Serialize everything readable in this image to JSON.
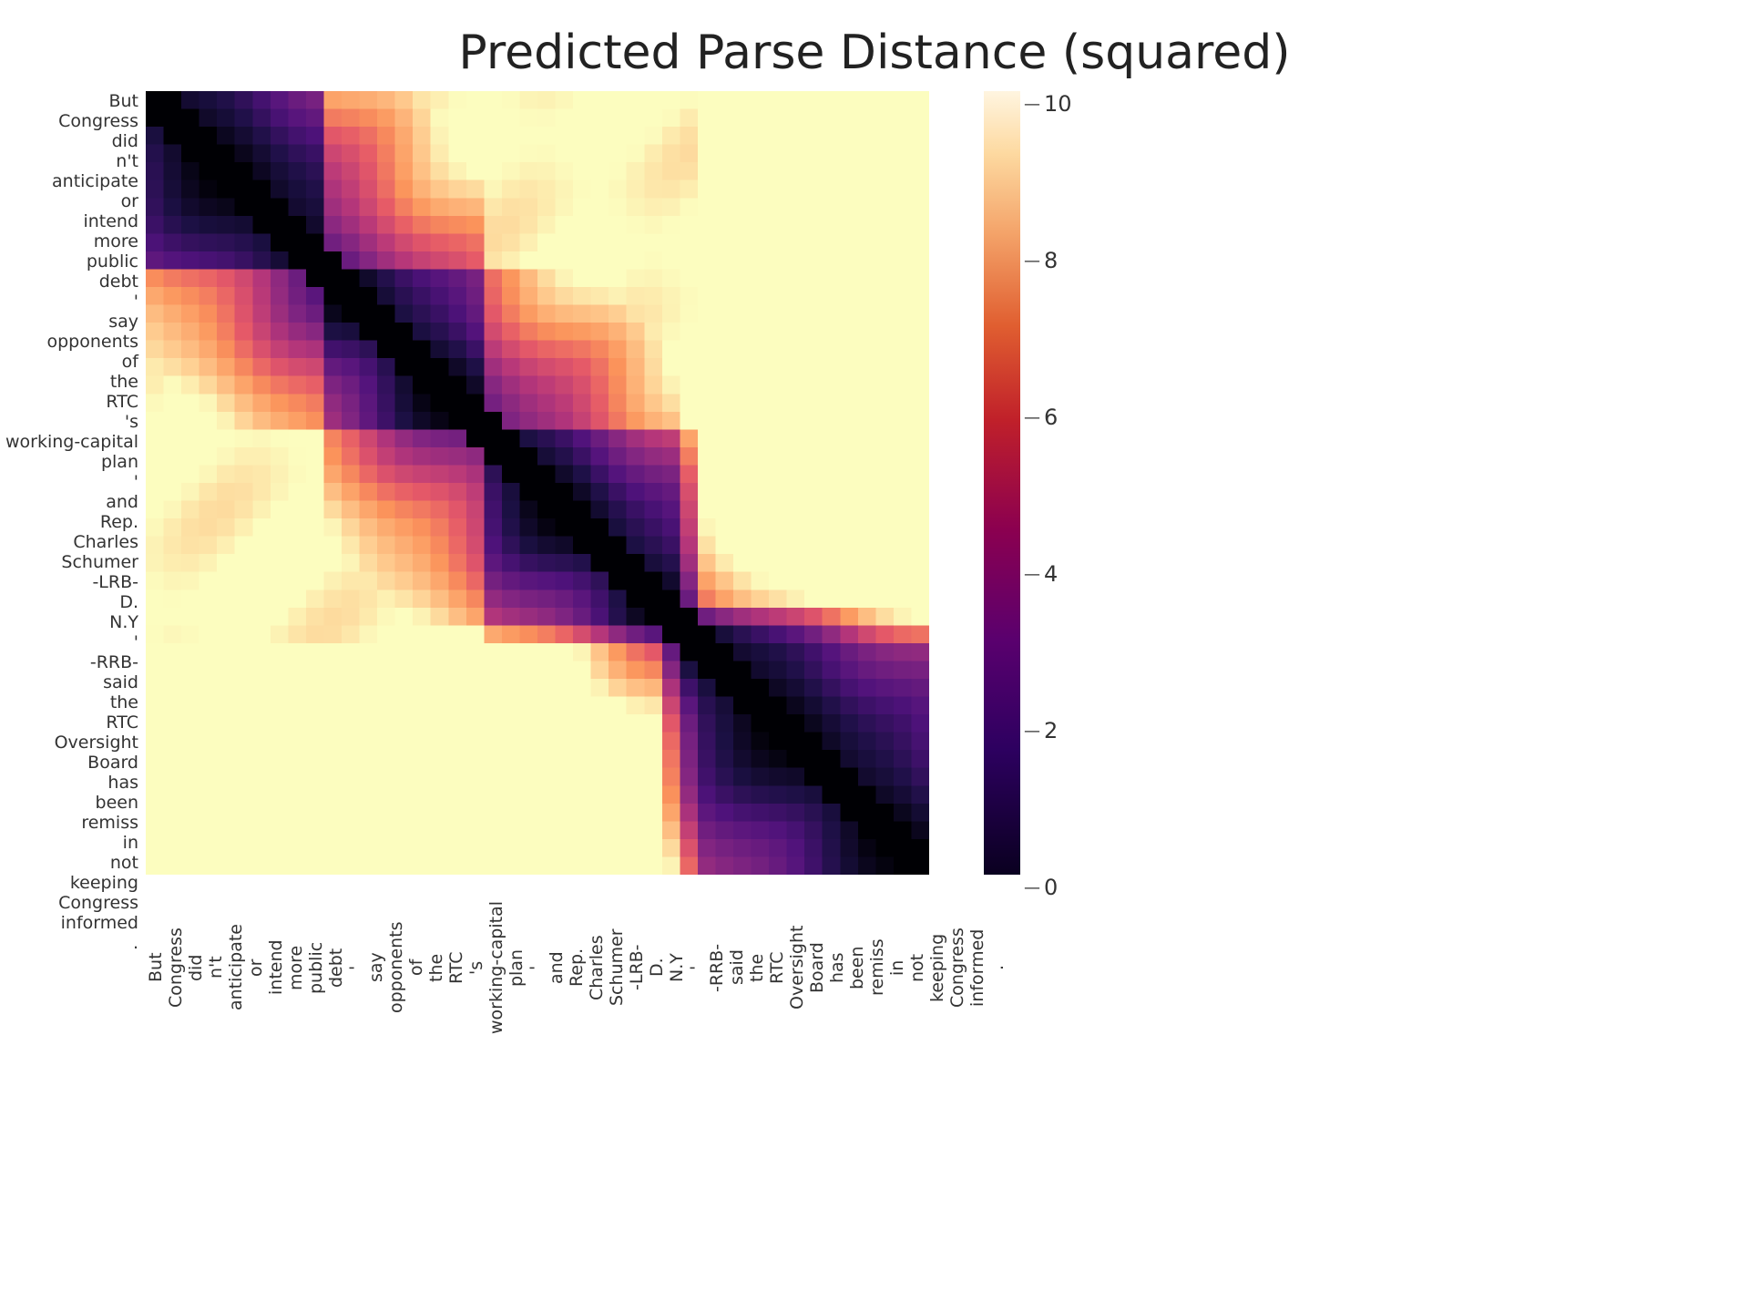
{
  "title": "Predicted Parse Distance (squared)",
  "y_labels": [
    "But",
    "Congress",
    "did",
    "n't",
    "anticipate",
    "or",
    "intend",
    "more",
    "public",
    "debt",
    "'",
    "say",
    "opponents",
    "of",
    "the",
    "RTC",
    "'s",
    "working-capital",
    "plan",
    "'",
    "and",
    "Rep.",
    "Charles",
    "Schumer",
    "-LRB-",
    "D.",
    "",
    "N.Y",
    "'",
    "-RRB-",
    "said",
    "the",
    "RTC",
    "Oversight",
    "Board",
    "has",
    "been",
    "remiss",
    "in",
    "not",
    "keeping",
    "Congress",
    "informed",
    "."
  ],
  "x_labels": [
    "But",
    "Congress",
    "did",
    "n't",
    "anticipate",
    "or",
    "intend",
    "more",
    "public",
    "debt",
    "'",
    "say",
    "opponents",
    "of",
    "the",
    "RTC",
    "'s",
    "working-capital",
    "plan",
    "'",
    "and",
    "Rep.",
    "Charles",
    "Schumer",
    "-LRB-",
    "D.",
    "",
    "N.Y",
    "'",
    "-RRB-",
    "said",
    "the",
    "RTC",
    "Oversight",
    "Board",
    "has",
    "been",
    "remiss",
    "in",
    "not",
    "keeping",
    "Congress",
    "informed",
    "."
  ],
  "colorbar": {
    "ticks": [
      {
        "label": "10",
        "pct": 0
      },
      {
        "label": "8",
        "pct": 20
      },
      {
        "label": "6",
        "pct": 40
      },
      {
        "label": "4",
        "pct": 60
      },
      {
        "label": "2",
        "pct": 80
      },
      {
        "label": "0",
        "pct": 100
      }
    ]
  }
}
